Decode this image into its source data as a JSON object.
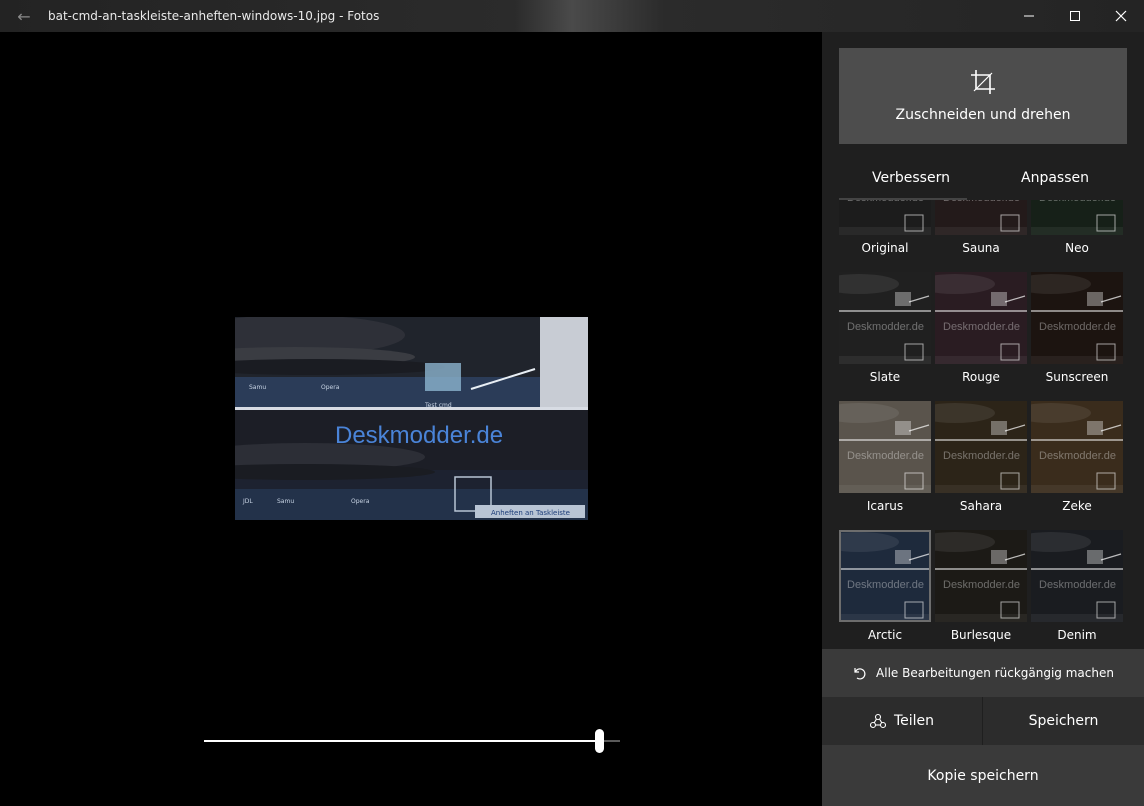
{
  "window": {
    "title": "bat-cmd-an-taskleiste-anheften-windows-10.jpg - Fotos",
    "back_icon": "back-arrow-icon",
    "minimize_icon": "minimize-icon",
    "maximize_icon": "maximize-icon",
    "close_icon": "close-icon"
  },
  "photo": {
    "watermark_text": "Deskmodder.de",
    "taskbar_top": [
      "Samu",
      "Opera",
      "Test cmd"
    ],
    "taskbar_bottom": [
      "JDL",
      "Samu",
      "Opera"
    ],
    "tooltip": "Anheften an Taskleiste"
  },
  "slider": {
    "value": 0.95
  },
  "panel": {
    "crop_label": "Zuschneiden und drehen",
    "crop_icon": "crop-rotate-icon",
    "tabs": [
      {
        "label": "Verbessern",
        "active": true
      },
      {
        "label": "Anpassen",
        "active": false
      }
    ],
    "filters": [
      {
        "label": "Original",
        "tint": "#1c1c1c"
      },
      {
        "label": "Sauna",
        "tint": "#231a1a"
      },
      {
        "label": "Neo",
        "tint": "#162018"
      },
      {
        "label": "Slate",
        "tint": "#202020"
      },
      {
        "label": "Rouge",
        "tint": "#2a1c22"
      },
      {
        "label": "Sunscreen",
        "tint": "#1c1410"
      },
      {
        "label": "Icarus",
        "tint": "#5a544c"
      },
      {
        "label": "Sahara",
        "tint": "#2c2418"
      },
      {
        "label": "Zeke",
        "tint": "#3a2c1c"
      },
      {
        "label": "Arctic",
        "tint": "#1e2a3c",
        "selected": true
      },
      {
        "label": "Burlesque",
        "tint": "#1c1a16"
      },
      {
        "label": "Denim",
        "tint": "#1a1c20"
      }
    ],
    "undo_label": "Alle Bearbeitungen rückgängig machen",
    "undo_icon": "undo-icon",
    "share_label": "Teilen",
    "share_icon": "share-icon",
    "save_label": "Speichern",
    "copy_label": "Kopie speichern"
  }
}
